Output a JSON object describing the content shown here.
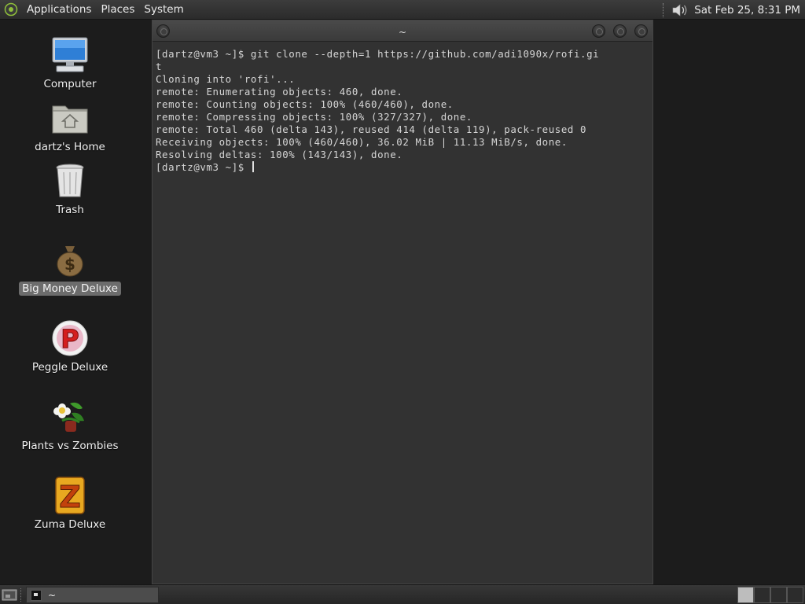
{
  "top_panel": {
    "menus": [
      "Applications",
      "Places",
      "System"
    ],
    "clock": "Sat Feb 25,  8:31 PM",
    "icons": {
      "menu_logo": "gnome-foot-icon",
      "volume": "speaker-icon"
    }
  },
  "desktop": {
    "icons": [
      {
        "label": "Computer",
        "icon": "computer-monitor-icon",
        "selected": false
      },
      {
        "label": "dartz's Home",
        "icon": "home-folder-icon",
        "selected": false
      },
      {
        "label": "Trash",
        "icon": "trash-can-icon",
        "selected": false
      },
      {
        "label": "Big Money Deluxe",
        "icon": "money-bag-icon",
        "selected": true
      },
      {
        "label": "Peggle Deluxe",
        "icon": "peggle-p-icon",
        "selected": false
      },
      {
        "label": "Plants vs Zombies",
        "icon": "plants-flower-icon",
        "selected": false
      },
      {
        "label": "Zuma Deluxe",
        "icon": "zuma-z-icon",
        "selected": false
      }
    ]
  },
  "terminal": {
    "title": "~",
    "lines": [
      "[dartz@vm3 ~]$ git clone --depth=1 https://github.com/adi1090x/rofi.gi",
      "t",
      "Cloning into 'rofi'...",
      "remote: Enumerating objects: 460, done.",
      "remote: Counting objects: 100% (460/460), done.",
      "remote: Compressing objects: 100% (327/327), done.",
      "remote: Total 460 (delta 143), reused 414 (delta 119), pack-reused 0",
      "Receiving objects: 100% (460/460), 36.02 MiB | 11.13 MiB/s, done.",
      "Resolving deltas: 100% (143/143), done."
    ],
    "prompt": "[dartz@vm3 ~]$ "
  },
  "bottom_panel": {
    "task_label": "~",
    "workspaces": 4,
    "active_workspace": 1
  },
  "colors": {
    "desktop_bg": "#1c1c1c",
    "terminal_bg": "#323232",
    "panel_bg": "#2b2b2b",
    "selection": "#6c6c6c"
  }
}
